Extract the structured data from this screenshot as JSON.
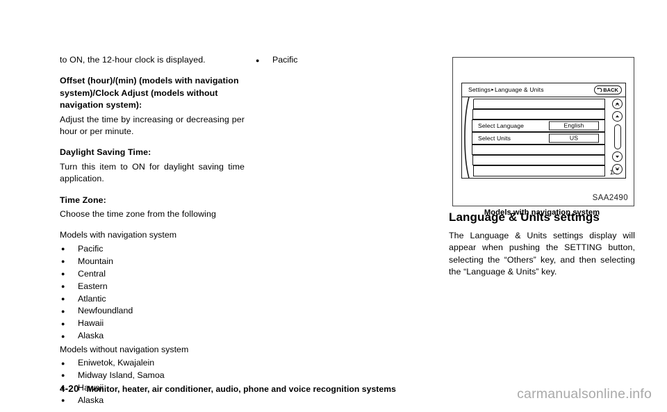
{
  "document": {
    "footer": {
      "page_number": "4-20",
      "chapter_title": "Monitor, heater, air conditioner, audio, phone and voice recognition systems",
      "watermark": "carmanualsonline.info"
    }
  },
  "left_column": {
    "intro_text": "to ON, the 12-hour clock is displayed.",
    "offset_heading": "Offset (hour)/(min) (models with navigation system)/Clock Adjust (models without navigation system):",
    "offset_text": "Adjust the time by increasing or decreasing per hour or per minute.",
    "daylight_heading": "Daylight Saving Time:",
    "daylight_text": "Turn this item to ON for daylight saving time application.",
    "timezone_heading": "Time Zone:",
    "timezone_text": "Choose the time zone from the following",
    "with_nav_label": "Models with navigation system",
    "with_nav_zones": [
      "Pacific",
      "Mountain",
      "Central",
      "Eastern",
      "Atlantic",
      "Newfoundland",
      "Hawaii",
      "Alaska"
    ],
    "without_nav_label": "Models without navigation system",
    "without_nav_zones": [
      "Eniwetok, Kwajalein",
      "Midway Island, Samoa",
      "Hawaii",
      "Alaska"
    ]
  },
  "middle_column": {
    "continued_zones": [
      "Pacific"
    ]
  },
  "right_column": {
    "figure": {
      "code": "SAA2490",
      "caption": "Models with navigation system",
      "screen": {
        "breadcrumb_root": "Settings",
        "breadcrumb_arrow": "▸",
        "breadcrumb_current": "Language & Units",
        "back_button_label": "BACK",
        "rows": [
          {
            "label": "Select Language",
            "value": "English"
          },
          {
            "label": "Select Units",
            "value": "US"
          }
        ],
        "page_indicator": "1/2",
        "scroll_controls": [
          "scroll-page-up-button",
          "scroll-up-button",
          "scroll-down-button",
          "scroll-page-down-button"
        ]
      }
    },
    "section_title": "Language & Units settings",
    "section_text": "The Language & Units settings display will appear when pushing the SETTING button, selecting the “Others” key, and then selecting the “Language & Units” key."
  }
}
